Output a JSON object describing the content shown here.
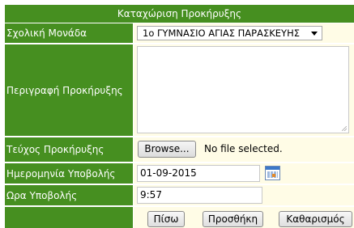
{
  "form": {
    "title": "Καταχώριση Προκήρυξης",
    "school": {
      "label": "Σχολική Μονάδα",
      "selected": "1ο ΓΥΜΝΑΣΙΟ ΑΓΙΑΣ ΠΑΡΑΣΚΕΥΗΣ"
    },
    "description": {
      "label": "Περιγραφή Προκήρυξης",
      "value": ""
    },
    "document": {
      "label": "Τεύχος Προκήρυξης",
      "browse_label": "Browse...",
      "file_status": "No file selected."
    },
    "submit_date": {
      "label": "Ημερομηνία Υποβολής",
      "value": "01-09-2015",
      "icon": "calendar-icon"
    },
    "submit_time": {
      "label": "Ωρα Υποβολής",
      "value": "9:57"
    },
    "actions": {
      "back_label": "Πίσω",
      "add_label": "Προσθήκη",
      "clear_label": "Καθαρισμός"
    }
  },
  "colors": {
    "header_green": "#468f20",
    "field_background": "#fffce6",
    "label_text": "#ffffff"
  }
}
